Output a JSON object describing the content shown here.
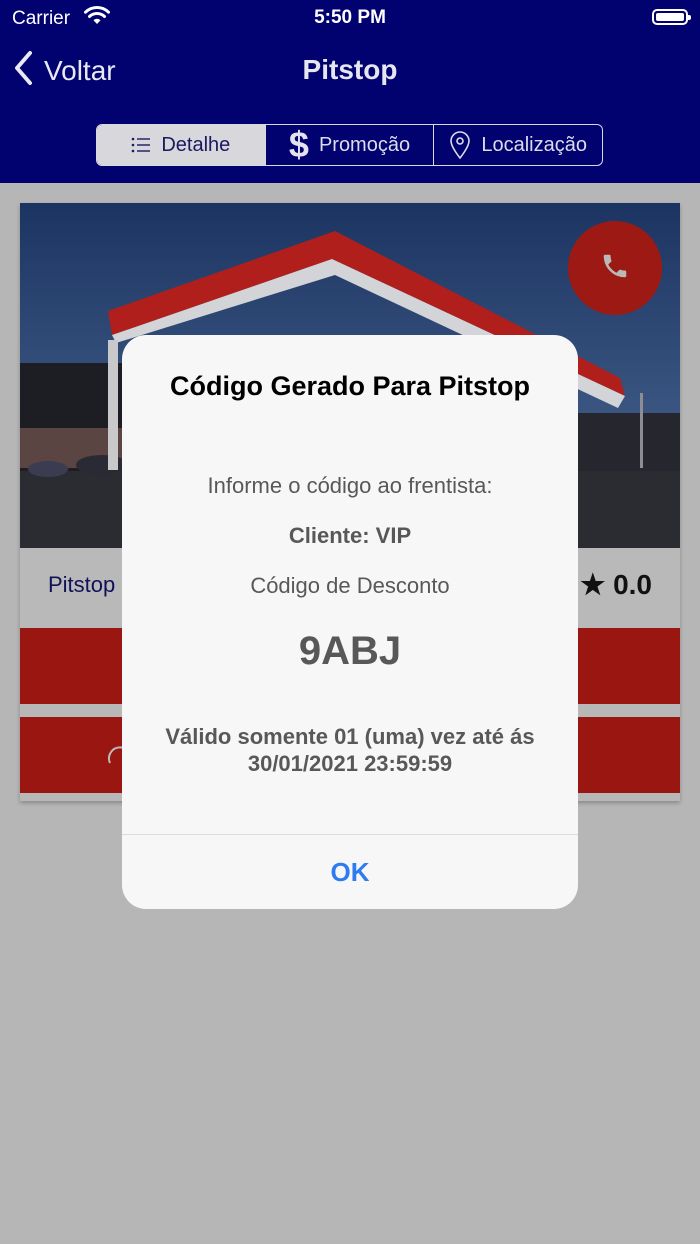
{
  "status_bar": {
    "carrier": "Carrier",
    "time": "5:50 PM"
  },
  "nav": {
    "back_label": "Voltar",
    "title": "Pitstop",
    "segments": [
      {
        "label": "Detalhe",
        "icon": "list-icon",
        "selected": true
      },
      {
        "label": "Promoção",
        "icon": "dollar-icon",
        "selected": false
      },
      {
        "label": "Localização",
        "icon": "location-pin-icon",
        "selected": false
      }
    ]
  },
  "card": {
    "station_name": "Pitstop",
    "rating": "★ 0.0",
    "call_icon": "phone-icon"
  },
  "alert": {
    "title": "Código Gerado Para Pitstop",
    "instruction": "Informe o código ao frentista:",
    "client": "Cliente: VIP",
    "code_label": "Código de Desconto",
    "code": "9ABJ",
    "validity": "Válido somente 01 (uma) vez até ás 30/01/2021 23:59:59",
    "ok_label": "OK"
  },
  "colors": {
    "nav_background": "#010170",
    "accent_red": "#9a1610",
    "alert_button": "#2f7bf0",
    "dim_overlay": "#b6b6b6"
  }
}
